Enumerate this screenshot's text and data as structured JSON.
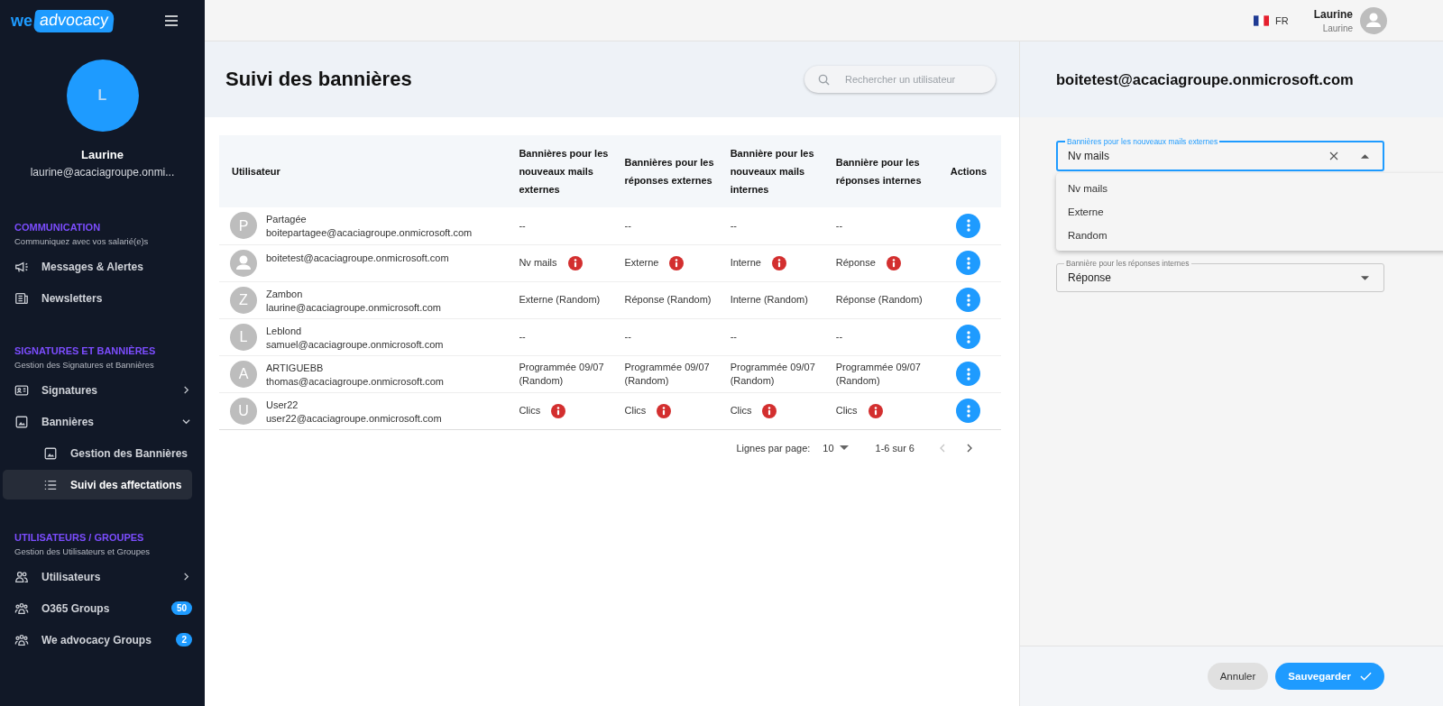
{
  "sidebar": {
    "logo": {
      "part_1": "we",
      "part_2": "advocacy"
    },
    "profile": {
      "initial": "L",
      "name": "Laurine",
      "email": "laurine@acaciagroupe.onmi..."
    },
    "sections": [
      {
        "title": "COMMUNICATION",
        "subtitle": "Communiquez avec vos salarié(e)s",
        "items": [
          {
            "kind": "link",
            "label": "Messages & Alertes",
            "selected": false
          },
          {
            "kind": "link",
            "label": "Newsletters",
            "selected": false
          }
        ]
      },
      {
        "title": "SIGNATURES ET BANNIÈRES",
        "subtitle": "Gestion des Signatures et Bannières",
        "items": [
          {
            "kind": "group",
            "label": "Signatures",
            "expanded": false,
            "selected": false
          },
          {
            "kind": "group",
            "label": "Bannières",
            "expanded": true,
            "selected": false,
            "children": [
              {
                "label": "Gestion des Bannières",
                "selected": false
              },
              {
                "label": "Suivi des affectations",
                "selected": true
              }
            ]
          }
        ]
      },
      {
        "title": "UTILISATEURS / GROUPES",
        "subtitle": "Gestion des Utilisateurs et Groupes",
        "items": [
          {
            "kind": "group",
            "label": "Utilisateurs",
            "expanded": false,
            "selected": false
          },
          {
            "kind": "link",
            "label": "O365 Groups",
            "badge": "50",
            "selected": false
          },
          {
            "kind": "link",
            "label": "We advocacy Groups",
            "badge": "2",
            "selected": false
          }
        ]
      }
    ]
  },
  "topbar": {
    "language": "FR",
    "user_name": "Laurine",
    "user_subtitle": "Laurine"
  },
  "page": {
    "title": "Suivi des bannières",
    "search": {
      "placeholder": "Rechercher un utilisateur"
    }
  },
  "table": {
    "columns": [
      "Utilisateur",
      "Bannières pour les nouveaux mails externes",
      "Bannières pour les réponses externes",
      "Bannière pour les nouveaux mails internes",
      "Bannière pour les réponses internes",
      "Actions"
    ],
    "rows": [
      {
        "cells": [
          {
            "avatar": {
              "kind": "letter",
              "letter": "P"
            },
            "name": "Partagée",
            "email": "boitepartagee@acaciagroupe.onmicrosoft.com"
          },
          {
            "text": "--",
            "info": false
          },
          {
            "text": "--",
            "info": false
          },
          {
            "text": "--",
            "info": false
          },
          {
            "text": "--",
            "info": false
          }
        ]
      },
      {
        "cells": [
          {
            "avatar": {
              "kind": "person"
            },
            "email": "boitetest@acaciagroupe.onmicrosoft.com"
          },
          {
            "text": "Nv mails",
            "info": true
          },
          {
            "text": "Externe",
            "info": true
          },
          {
            "text": "Interne",
            "info": true
          },
          {
            "text": "Réponse",
            "info": true
          }
        ]
      },
      {
        "cells": [
          {
            "avatar": {
              "kind": "letter",
              "letter": "Z"
            },
            "name": "Zambon",
            "email": "laurine@acaciagroupe.onmicrosoft.com"
          },
          {
            "text": "Externe (Random)",
            "info": false
          },
          {
            "text": "Réponse (Random)",
            "info": false
          },
          {
            "text": "Interne (Random)",
            "info": false
          },
          {
            "text": "Réponse (Random)",
            "info": false
          }
        ]
      },
      {
        "cells": [
          {
            "avatar": {
              "kind": "letter",
              "letter": "L"
            },
            "name": "Leblond",
            "email": "samuel@acaciagroupe.onmicrosoft.com"
          },
          {
            "text": "--",
            "info": false
          },
          {
            "text": "--",
            "info": false
          },
          {
            "text": "--",
            "info": false
          },
          {
            "text": "--",
            "info": false
          }
        ]
      },
      {
        "cells": [
          {
            "avatar": {
              "kind": "letter",
              "letter": "A"
            },
            "name": "ARTIGUEBB",
            "email": "thomas@acaciagroupe.onmicrosoft.com"
          },
          {
            "text": "Programmée 09/07 (Random)",
            "info": false
          },
          {
            "text": "Programmée 09/07 (Random)",
            "info": false
          },
          {
            "text": "Programmée 09/07 (Random)",
            "info": false
          },
          {
            "text": "Programmée 09/07 (Random)",
            "info": false
          }
        ]
      },
      {
        "cells": [
          {
            "avatar": {
              "kind": "letter",
              "letter": "U"
            },
            "name": "User22",
            "email": "user22@acaciagroupe.onmicrosoft.com"
          },
          {
            "text": "Clics",
            "info": true
          },
          {
            "text": "Clics",
            "info": true
          },
          {
            "text": "Clics",
            "info": true
          },
          {
            "text": "Clics",
            "info": true
          }
        ]
      }
    ]
  },
  "pagination": {
    "rows_label": "Lignes par page:",
    "rows_value": "10",
    "range": "1-6 sur 6",
    "prev_disabled": true,
    "next_disabled": false
  },
  "panel": {
    "title": "boitetest@acaciagroupe.onmicrosoft.com",
    "fields": [
      {
        "label": "Bannières pour les nouveaux mails externes",
        "value": "Nv mails",
        "open": true,
        "options": [
          "Nv mails",
          "Externe",
          "Random"
        ]
      },
      {
        "label": "Bannière pour les réponses internes",
        "value": "Réponse",
        "open": false
      }
    ],
    "buttons": {
      "cancel": "Annuler",
      "save": "Sauvegarder"
    }
  }
}
